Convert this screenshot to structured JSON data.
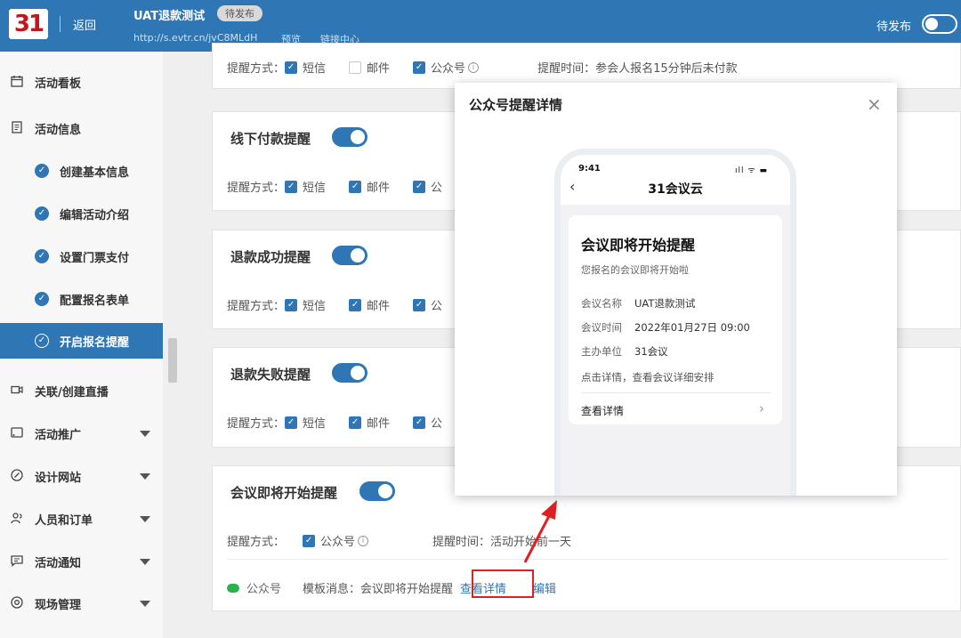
{
  "colors": {
    "primary": "#2f76b4",
    "highlight": "#e02020"
  },
  "topbar": {
    "logo_text": "31",
    "back_label": "返回",
    "event_title": "UAT退款测试",
    "status_tag": "待发布",
    "url": "http://s.evtr.cn/jvC8MLdH",
    "preview_link": "预览",
    "link_center": "链接中心",
    "publish_status": "待发布",
    "publish_toggle_on": false
  },
  "sidebar": {
    "items": [
      {
        "label": "活动看板",
        "icon": "calendar-icon"
      },
      {
        "label": "活动信息",
        "icon": "document-icon"
      },
      {
        "label": "关联/创建直播",
        "icon": "video-icon"
      },
      {
        "label": "活动推广",
        "icon": "cast-icon"
      },
      {
        "label": "设计网站",
        "icon": "compass-icon"
      },
      {
        "label": "人员和订单",
        "icon": "users-icon"
      },
      {
        "label": "活动通知",
        "icon": "message-icon"
      },
      {
        "label": "现场管理",
        "icon": "target-icon"
      }
    ],
    "sub_items": [
      {
        "label": "创建基本信息",
        "done": true
      },
      {
        "label": "编辑活动介绍",
        "done": true
      },
      {
        "label": "设置门票支付",
        "done": true
      },
      {
        "label": "配置报名表单",
        "done": true
      },
      {
        "label": "开启报名提醒",
        "done": true,
        "active": true
      }
    ]
  },
  "main": {
    "top_partial": {
      "method_label": "提醒方式：",
      "opt_sms": "短信",
      "opt_email": "邮件",
      "opt_wechat": "公众号",
      "remind_time": "提醒时间：参会人报名15分钟后未付款"
    },
    "cards": [
      {
        "title": "线下付款提醒",
        "enabled": true,
        "method_label": "提醒方式：",
        "opt_sms": "短信",
        "opt_email": "邮件",
        "opt_wechat": "公"
      },
      {
        "title": "退款成功提醒",
        "enabled": true,
        "method_label": "提醒方式：",
        "opt_sms": "短信",
        "opt_email": "邮件",
        "opt_wechat": "公"
      },
      {
        "title": "退款失败提醒",
        "enabled": true,
        "method_label": "提醒方式：",
        "opt_sms": "短信",
        "opt_email": "邮件",
        "opt_wechat": "公"
      }
    ],
    "meeting_card": {
      "title": "会议即将开始提醒",
      "enabled": true,
      "method_label": "提醒方式：",
      "opt_wechat": "公众号",
      "remind_time": "提醒时间：活动开始前一天",
      "channel": "公众号",
      "template_msg": "模板消息：会议即将开始提醒",
      "view_detail": "查看详情",
      "edit": "编辑"
    }
  },
  "modal": {
    "title": "公众号提醒详情",
    "close": "×",
    "phone": {
      "time": "9:41",
      "status_icons": "ıll ᯤ ▬",
      "back": "‹",
      "account_name": "31会议云",
      "msg_title": "会议即将开始提醒",
      "msg_sub": "您报名的会议即将开始啦",
      "rows": [
        {
          "key": "会议名称",
          "value": "UAT退款测试"
        },
        {
          "key": "会议时间",
          "value": "2022年01月27日 09:00"
        },
        {
          "key": "主办单位",
          "value": "31会议"
        }
      ],
      "note": "点击详情，查看会议详细安排",
      "view_detail": "查看详情",
      "chevron": "›"
    }
  }
}
